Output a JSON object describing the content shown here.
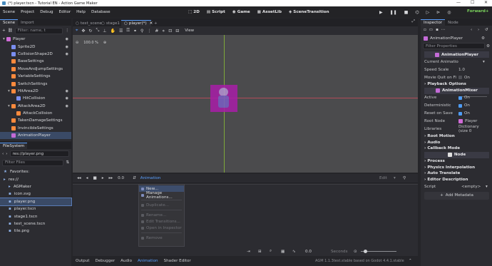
{
  "window": {
    "title": "(*) player.tscn - Tutorial EN - Action Game Maker",
    "minimize": "—",
    "maximize": "☐",
    "close": "✕"
  },
  "menu": [
    "Scene",
    "Project",
    "Debug",
    "Editor",
    "Help",
    "Database"
  ],
  "workspaces": [
    "2D",
    "Script",
    "Game",
    "AssetLib",
    "SceneTransition"
  ],
  "run_label": "Forward+",
  "scene_dock": {
    "tabs": [
      "Scene",
      "Import"
    ],
    "filter_placeholder": "Filter: name, t",
    "nodes": [
      {
        "name": "Player",
        "icon": "#d06bd7",
        "indent": 0,
        "eye": true
      },
      {
        "name": "Sprite2D",
        "icon": "#7a8ef0",
        "indent": 1,
        "eye": true
      },
      {
        "name": "CollisionShape2D",
        "icon": "#7a8ef0",
        "indent": 1,
        "eye": true
      },
      {
        "name": "BaseSettings",
        "icon": "#ff8a3d",
        "indent": 1,
        "eye": false
      },
      {
        "name": "MoveAndJumpSettings",
        "icon": "#ff8a3d",
        "indent": 1,
        "eye": false
      },
      {
        "name": "VariableSettings",
        "icon": "#ff8a3d",
        "indent": 1,
        "eye": false
      },
      {
        "name": "SwitchSettings",
        "icon": "#ff8a3d",
        "indent": 1,
        "eye": false
      },
      {
        "name": "HitArea2D",
        "icon": "#ff8a3d",
        "indent": 1,
        "eye": true
      },
      {
        "name": "HitCollision",
        "icon": "#7a8ef0",
        "indent": 2,
        "eye": true
      },
      {
        "name": "AttackArea2D",
        "icon": "#ff8a3d",
        "indent": 1,
        "eye": true
      },
      {
        "name": "AttackCollision",
        "icon": "#ff8a3d",
        "indent": 2,
        "eye": false
      },
      {
        "name": "TakenDamageSettings",
        "icon": "#ff8a3d",
        "indent": 1,
        "eye": false
      },
      {
        "name": "InvincibleSettings",
        "icon": "#ff8a3d",
        "indent": 1,
        "eye": false
      },
      {
        "name": "AnimationPlayer",
        "icon": "#c46bd7",
        "indent": 1,
        "eye": false,
        "selected": true
      }
    ]
  },
  "filesystem": {
    "tab": "FileSystem",
    "path": "res://player.png",
    "filter_placeholder": "Filter Files",
    "items": [
      {
        "name": "Favorites:",
        "icon": "★",
        "indent": 0
      },
      {
        "name": "res://",
        "icon": "▸",
        "indent": 0
      },
      {
        "name": "AGMaker",
        "icon": "▸",
        "indent": 1
      },
      {
        "name": "icon.svg",
        "icon": "▪",
        "indent": 1
      },
      {
        "name": "player.png",
        "icon": "▪",
        "indent": 1,
        "selected": true
      },
      {
        "name": "player.tscn",
        "icon": "▪",
        "indent": 1
      },
      {
        "name": "stage1.tscn",
        "icon": "▪",
        "indent": 1
      },
      {
        "name": "test_scene.tscn",
        "icon": "▪",
        "indent": 1
      },
      {
        "name": "tile.png",
        "icon": "▪",
        "indent": 1
      }
    ]
  },
  "editor_tabs": [
    "test_scene",
    "stage1",
    "player(*)"
  ],
  "viewport": {
    "zoom": "100.0 %",
    "view_label": "View"
  },
  "animation_panel": {
    "time": "0.0",
    "animation_button": "Animation",
    "edit_label": "Edit",
    "bottom_time": "0.0",
    "seconds": "Seconds",
    "menu": [
      {
        "label": "New...",
        "enabled": true
      },
      {
        "label": "Manage Animations...",
        "enabled": true
      },
      {
        "sep": true
      },
      {
        "label": "Duplicate...",
        "enabled": false
      },
      {
        "sep": true
      },
      {
        "label": "Rename...",
        "enabled": false
      },
      {
        "label": "Edit Transitions...",
        "enabled": false
      },
      {
        "label": "Open in Inspector",
        "enabled": false
      },
      {
        "sep": true
      },
      {
        "label": "Remove",
        "enabled": false
      }
    ]
  },
  "bottom_tabs": [
    "Output",
    "Debugger",
    "Audio",
    "Animation",
    "Shader Editor"
  ],
  "version": "AGM 1.1.3test.stable based on Godot 4.4.1.stable",
  "inspector": {
    "tabs": [
      "Inspector",
      "Node"
    ],
    "object": "AnimationPlayer",
    "filter_placeholder": "Filter Properties",
    "class_header": "AnimationPlayer",
    "current_animation": "Current Animatio",
    "speed_scale_label": "Speed Scale",
    "speed_scale_value": "1.0",
    "move_quit_label": "Movie Quit on Fi",
    "on": "On",
    "playback_options": "Playback Options",
    "mixer_header": "AnimationMixer",
    "active_label": "Active",
    "deterministic_label": "Deterministic",
    "reset_label": "Reset on Save",
    "root_node_label": "Root Node",
    "root_node_value": "Player",
    "libraries_label": "Libraries",
    "libraries_value": "Dictionary (size 0",
    "sections_a": [
      "Root Motion",
      "Audio",
      "Callback Mode"
    ],
    "node_header": "Node",
    "sections_b": [
      "Process",
      "Physics Interpolation",
      "Auto Translate",
      "Editor Description"
    ],
    "script_label": "Script",
    "script_value": "<empty>",
    "add_metadata": "Add Metadata"
  }
}
